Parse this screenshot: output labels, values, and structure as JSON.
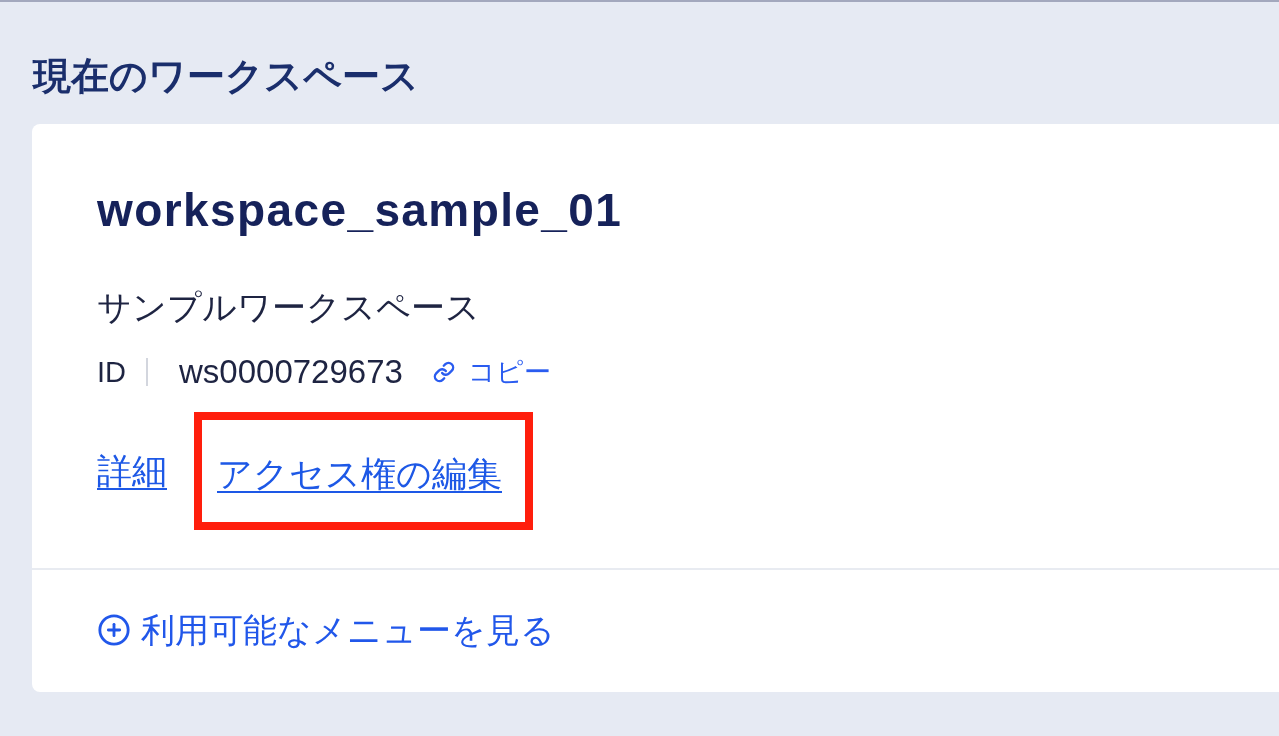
{
  "section_title": "現在のワークスペース",
  "workspace": {
    "name": "workspace_sample_01",
    "description": "サンプルワークスペース",
    "id_label": "ID",
    "id_value": "ws0000729673",
    "copy_link": "コピー",
    "links": [
      {
        "label": "詳細",
        "highlighted": false
      },
      {
        "label": "アクセス権の編集",
        "highlighted": true
      }
    ],
    "footer_link": "利用可能なメニューを見る"
  }
}
